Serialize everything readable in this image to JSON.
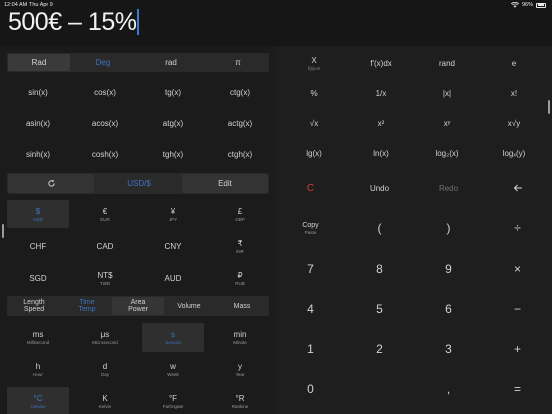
{
  "status": {
    "time": "12:04 AM",
    "date": "Thu Apr 9",
    "battery": "96%"
  },
  "display": {
    "expression": "500€ – 15%"
  },
  "angle_bar": {
    "rad": "Rad",
    "deg": "Deg",
    "rad_fn": "rad",
    "pi": "π"
  },
  "trig": [
    [
      "sin(x)",
      "cos(x)",
      "tg(x)",
      "ctg(x)"
    ],
    [
      "asin(x)",
      "acos(x)",
      "atg(x)",
      "actg(x)"
    ],
    [
      "sinh(x)",
      "cosh(x)",
      "tgh(x)",
      "ctgh(x)"
    ]
  ],
  "sci": {
    "row1": {
      "x_label": "X",
      "x_sub": "f(x)=0",
      "integral": "f'(x)dx",
      "rand": "rand",
      "e": "e"
    },
    "row2": [
      "%",
      "1/x",
      "|x|",
      "x!"
    ],
    "row3": [
      "√x",
      "x²",
      "xʸ",
      "x√y"
    ],
    "row4": [
      "lg(x)",
      "ln(x)",
      "log₂(x)",
      "logₓ(y)"
    ]
  },
  "convert_bar": {
    "refresh_icon": "refresh-icon",
    "pair": "USD/$",
    "edit": "Edit"
  },
  "currencies": [
    [
      {
        "sym": "$",
        "code": "USD",
        "selected": true
      },
      {
        "sym": "€",
        "code": "EUR"
      },
      {
        "sym": "¥",
        "code": "JPY"
      },
      {
        "sym": "£",
        "code": "GBP"
      }
    ],
    [
      {
        "sym": "CHF",
        "code": ""
      },
      {
        "sym": "CAD",
        "code": ""
      },
      {
        "sym": "CNY",
        "code": ""
      },
      {
        "sym": "₹",
        "code": "INR"
      }
    ],
    [
      {
        "sym": "SGD",
        "code": ""
      },
      {
        "sym": "NT$",
        "code": "TWD"
      },
      {
        "sym": "AUD",
        "code": ""
      },
      {
        "sym": "₽",
        "code": "RUB"
      }
    ]
  ],
  "categories": [
    {
      "a": "Length",
      "b": "Speed"
    },
    {
      "a": "Time",
      "b": "Temp",
      "active": true
    },
    {
      "a": "Area",
      "b": "Power"
    },
    {
      "a": "Volume",
      "b": ""
    },
    {
      "a": "Mass",
      "b": ""
    }
  ],
  "units": [
    [
      {
        "sym": "ms",
        "name": "Millisecond"
      },
      {
        "sym": "μs",
        "name": "Microsecond"
      },
      {
        "sym": "s",
        "name": "Second",
        "selected": true
      },
      {
        "sym": "min",
        "name": "Minute"
      }
    ],
    [
      {
        "sym": "h",
        "name": "Hour"
      },
      {
        "sym": "d",
        "name": "Day"
      },
      {
        "sym": "w",
        "name": "Week"
      },
      {
        "sym": "y",
        "name": "Year"
      }
    ],
    [
      {
        "sym": "°C",
        "name": "Celsius",
        "selected": true
      },
      {
        "sym": "K",
        "name": "Kelvin"
      },
      {
        "sym": "°F",
        "name": "Farhngate"
      },
      {
        "sym": "°R",
        "name": "Rankine"
      }
    ]
  ],
  "keypad": {
    "clear": "C",
    "undo": "Undo",
    "redo": "Redo",
    "backspace_icon": "backspace-icon",
    "copy": "Copy",
    "paste": "Paste",
    "open_paren": "(",
    "close_paren": ")",
    "divide": "÷",
    "rows": [
      [
        "7",
        "8",
        "9",
        "×"
      ],
      [
        "4",
        "5",
        "6",
        "−"
      ],
      [
        "1",
        "2",
        "3",
        "+"
      ]
    ],
    "zero": "0",
    "comma": ",",
    "equals": "="
  }
}
